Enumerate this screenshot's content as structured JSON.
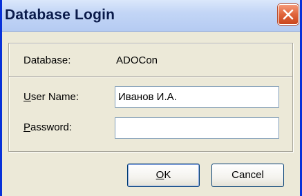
{
  "window": {
    "title": "Database Login",
    "close_icon": "close-icon"
  },
  "colors": {
    "frame_blue": "#0831d9",
    "dialog_bg": "#ece9d8",
    "close_red": "#e0643c"
  },
  "form": {
    "database_label": "Database:",
    "database_value": "ADOCon",
    "username_label_mnemonic": "U",
    "username_label_rest": "ser Name:",
    "username_value": "Иванов И.А.",
    "password_label_mnemonic": "P",
    "password_label_rest": "assword:",
    "password_value": ""
  },
  "buttons": {
    "ok_mnemonic": "O",
    "ok_rest": "K",
    "cancel_label": "Cancel"
  }
}
